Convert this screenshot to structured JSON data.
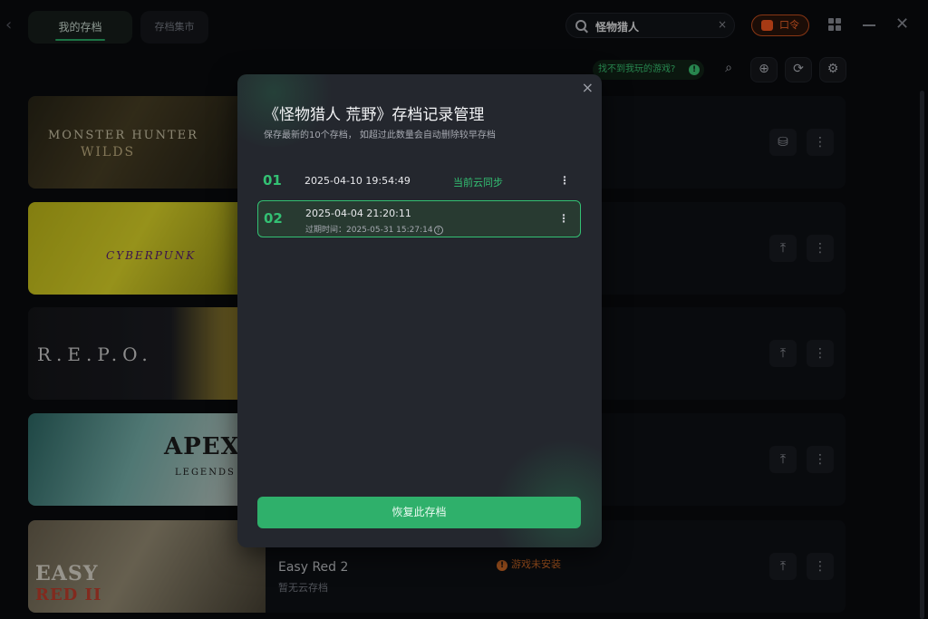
{
  "header": {
    "tabs": [
      {
        "label": "我的存档",
        "active": true
      },
      {
        "label": "存档集市",
        "active": false
      }
    ],
    "search": {
      "value": "怪物猎人",
      "clear_glyph": "×"
    },
    "cmd_button": {
      "label": "口令"
    },
    "accent_color": "#2bb36a"
  },
  "toolbar": {
    "hint": "找不到我玩的游戏?",
    "help_glyph": "!",
    "icons": [
      "search-icon",
      "add-icon",
      "sync-icon",
      "settings-icon"
    ]
  },
  "games": [
    {
      "cover_text": "MONSTER HUNTER",
      "cover_text2": "WILDS",
      "buttons": [
        "cloud-save-icon",
        "more-icon"
      ]
    },
    {
      "cover_text": "CYBERPUNK",
      "buttons": [
        "upload-icon",
        "more-icon"
      ]
    },
    {
      "cover_text": "R.E.P.O.",
      "buttons": [
        "upload-icon",
        "more-icon"
      ]
    },
    {
      "cover_text": "APEX",
      "cover_text2": "LEGENDS",
      "buttons": [
        "upload-icon",
        "more-icon"
      ]
    },
    {
      "cover_text": "EASY",
      "cover_text2": "RED II",
      "title": "Easy Red 2",
      "subtitle": "暂无云存档",
      "status": "游戏未安装",
      "buttons": [
        "upload-icon",
        "more-icon"
      ]
    }
  ],
  "modal": {
    "title": "《怪物猎人 荒野》存档记录管理",
    "subtitle": "保存最新的10个存档， 如超过此数量会自动删除较早存档",
    "close_glyph": "×",
    "saves": [
      {
        "index": "01",
        "date": "2025-04-10 19:54:49",
        "status": "当前云同步",
        "selected": false
      },
      {
        "index": "02",
        "date": "2025-04-04 21:20:11",
        "expiry": "过期时间：2025-05-31 15:27:14",
        "selected": true
      }
    ],
    "restore_label": "恢复此存档"
  }
}
